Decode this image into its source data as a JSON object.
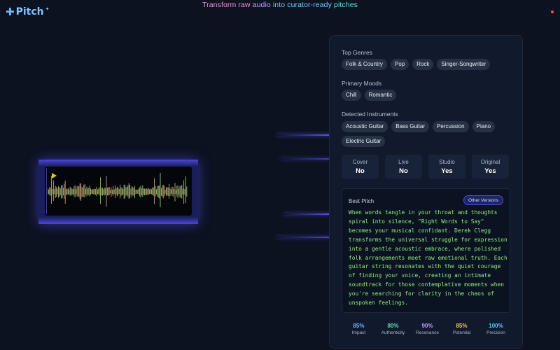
{
  "app": {
    "logo_text": "Pitch",
    "tagline_words": [
      "Transform raw",
      "audio",
      "into",
      "curator-ready",
      "pitches"
    ]
  },
  "colors": {
    "background": "#0c1220",
    "panel": "#101a2c",
    "accent": "#5f5aff",
    "play": "#f0c020",
    "pitch_text": "#8ef07a"
  },
  "player": {
    "play_icon": "play-icon"
  },
  "analysis": {
    "genres": {
      "label": "Top Genres",
      "items": [
        "Folk & Country",
        "Pop",
        "Rock",
        "Singer-Songwriter"
      ]
    },
    "moods": {
      "label": "Primary Moods",
      "items": [
        "Chill",
        "Romantic"
      ]
    },
    "instruments": {
      "label": "Detected Instruments",
      "items": [
        "Acoustic Guitar",
        "Bass Guitar",
        "Percussion",
        "Piano",
        "Electric Guitar"
      ]
    },
    "attributes": [
      {
        "label": "Cover",
        "value": "No"
      },
      {
        "label": "Live",
        "value": "No"
      },
      {
        "label": "Studio",
        "value": "Yes"
      },
      {
        "label": "Original",
        "value": "Yes"
      }
    ],
    "best_pitch": {
      "title": "Best Pitch",
      "other_versions_label": "Other Versions",
      "text": "When words tangle in your throat and thoughts spiral into silence, \"Right Words to Say\" becomes your musical confidant. Derek Clegg transforms the universal struggle for expression into a gentle acoustic embrace, where polished folk arrangements meet raw emotional truth. Each guitar string resonates with the quiet courage of finding your voice, creating an intimate soundtrack for those contemplative moments when you're searching for clarity in the chaos of unspoken feelings."
    },
    "scores": [
      {
        "percent": "85%",
        "label": "Impact",
        "color": "#6fb8ff"
      },
      {
        "percent": "80%",
        "label": "Authenticity",
        "color": "#5fdfb0"
      },
      {
        "percent": "90%",
        "label": "Resonance",
        "color": "#c49bff"
      },
      {
        "percent": "85%",
        "label": "Potential",
        "color": "#f5c84a"
      },
      {
        "percent": "100%",
        "label": "Precision",
        "color": "#5fc7ff"
      }
    ]
  }
}
